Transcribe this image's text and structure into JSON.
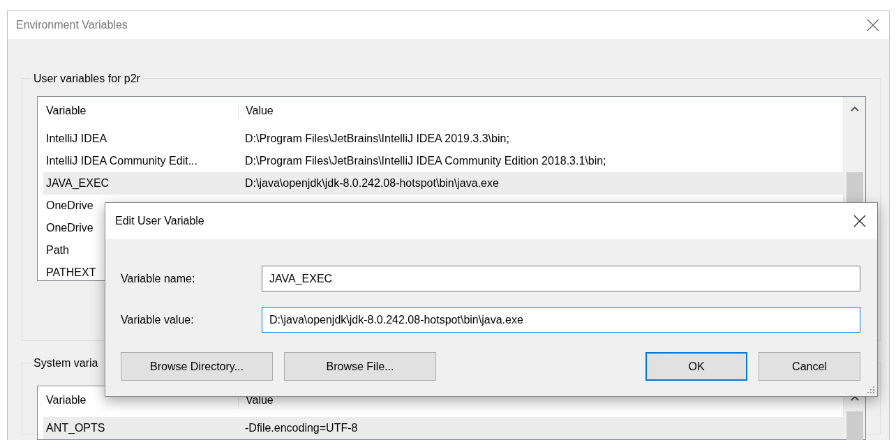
{
  "window": {
    "title": "Environment Variables"
  },
  "user_variables": {
    "title": "User variables for p2r",
    "columns": [
      "Variable",
      "Value"
    ],
    "rows": [
      {
        "variable": "IntelliJ IDEA",
        "value": "D:\\Program Files\\JetBrains\\IntelliJ IDEA 2019.3.3\\bin;",
        "selected": false
      },
      {
        "variable": "IntelliJ IDEA Community Edit...",
        "value": "D:\\Program Files\\JetBrains\\IntelliJ IDEA Community Edition 2018.3.1\\bin;",
        "selected": false
      },
      {
        "variable": "JAVA_EXEC",
        "value": "D:\\java\\openjdk\\jdk-8.0.242.08-hotspot\\bin\\java.exe",
        "selected": true
      },
      {
        "variable": "OneDrive",
        "selected": false
      },
      {
        "variable": "OneDrive",
        "selected": false
      },
      {
        "variable": "Path",
        "selected": false
      },
      {
        "variable": "PATHEXT",
        "selected": false
      }
    ]
  },
  "system_variables": {
    "title": "System varia",
    "columns": [
      "Variable",
      "Value"
    ],
    "rows": [
      {
        "variable": "ANT_OPTS",
        "value": "-Dfile.encoding=UTF-8",
        "selected": true
      }
    ]
  },
  "dialog": {
    "title": "Edit User Variable",
    "fields": [
      {
        "label": "Variable name:",
        "value": "JAVA_EXEC",
        "focused": false
      },
      {
        "label": "Variable value:",
        "value": "D:\\java\\openjdk\\jdk-8.0.242.08-hotspot\\bin\\java.exe",
        "focused": true
      }
    ],
    "buttons": [
      {
        "label": "Browse Directory...",
        "default": false
      },
      {
        "label": "Browse File...",
        "default": false
      },
      {
        "label": "OK",
        "default": true
      },
      {
        "label": "Cancel",
        "default": false
      }
    ]
  }
}
